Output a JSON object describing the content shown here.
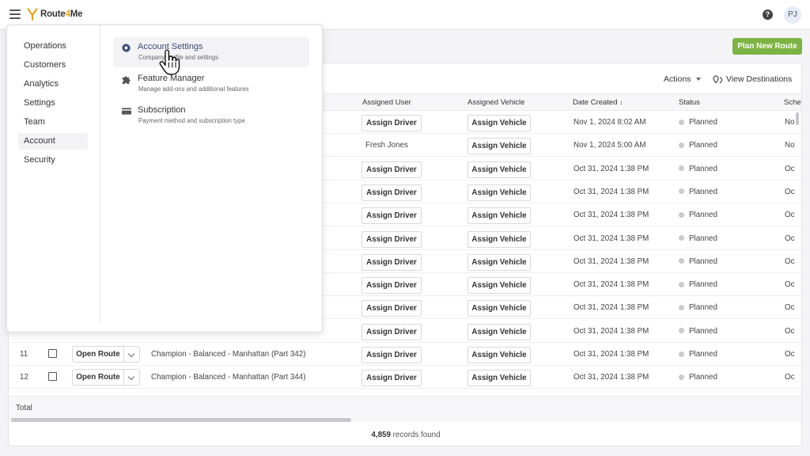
{
  "topbar": {
    "logo": {
      "text_a": "Route",
      "text_b": "4",
      "text_c": "Me"
    },
    "help_glyph": "?",
    "avatar_initials": "PJ"
  },
  "header": {
    "plan_button": "Plan New Route"
  },
  "toolbar": {
    "actions": "Actions",
    "view_destinations": "View Destinations"
  },
  "table": {
    "columns": {
      "assigned_user": "Assigned User",
      "assigned_vehicle": "Assigned Vehicle",
      "date_created": "Date Created",
      "status": "Status",
      "schedule": "Sched"
    },
    "rows": [
      {
        "user": "Assign Driver",
        "user_is_button": true,
        "vehicle": "Assign Vehicle",
        "date": "Nov 1, 2024 8:02 AM",
        "status": "Planned",
        "sched": "No"
      },
      {
        "user": "Fresh Jones",
        "user_is_button": false,
        "vehicle": "Assign Vehicle",
        "date": "Nov 1, 2024 5:00 AM",
        "status": "Planned",
        "sched": "No"
      },
      {
        "user": "Assign Driver",
        "user_is_button": true,
        "vehicle": "Assign Vehicle",
        "date": "Oct 31, 2024 1:38 PM",
        "status": "Planned",
        "sched": "Oc"
      },
      {
        "user": "Assign Driver",
        "user_is_button": true,
        "vehicle": "Assign Vehicle",
        "date": "Oct 31, 2024 1:38 PM",
        "status": "Planned",
        "sched": "Oc"
      },
      {
        "user": "Assign Driver",
        "user_is_button": true,
        "vehicle": "Assign Vehicle",
        "date": "Oct 31, 2024 1:38 PM",
        "status": "Planned",
        "sched": "Oc"
      },
      {
        "user": "Assign Driver",
        "user_is_button": true,
        "vehicle": "Assign Vehicle",
        "date": "Oct 31, 2024 1:38 PM",
        "status": "Planned",
        "sched": "Oc"
      },
      {
        "user": "Assign Driver",
        "user_is_button": true,
        "vehicle": "Assign Vehicle",
        "date": "Oct 31, 2024 1:38 PM",
        "status": "Planned",
        "sched": "Oc"
      },
      {
        "user": "Assign Driver",
        "user_is_button": true,
        "vehicle": "Assign Vehicle",
        "date": "Oct 31, 2024 1:38 PM",
        "status": "Planned",
        "sched": "Oc"
      },
      {
        "user": "Assign Driver",
        "user_is_button": true,
        "vehicle": "Assign Vehicle",
        "date": "Oct 31, 2024 1:38 PM",
        "status": "Planned",
        "sched": "Oc"
      },
      {
        "user": "Assign Driver",
        "user_is_button": true,
        "vehicle": "Assign Vehicle",
        "date": "Oct 31, 2024 1:38 PM",
        "status": "Planned",
        "sched": "Oc"
      },
      {
        "num": "11",
        "open": "Open Route",
        "name": "Champion - Balanced - Manhattan (Part 342)",
        "user": "Assign Driver",
        "user_is_button": true,
        "vehicle": "Assign Vehicle",
        "date": "Oct 31, 2024 1:38 PM",
        "status": "Planned",
        "sched": "Oc"
      },
      {
        "num": "12",
        "open": "Open Route",
        "name": "Champion - Balanced - Manhattan (Part 344)",
        "user": "Assign Driver",
        "user_is_button": true,
        "vehicle": "Assign Vehicle",
        "date": "Oct 31, 2024 1:38 PM",
        "status": "Planned",
        "sched": "Oc"
      }
    ],
    "total_label": "Total",
    "records_count": "4,859",
    "records_suffix": " records found"
  },
  "menu": {
    "left_items": [
      "Operations",
      "Customers",
      "Analytics",
      "Settings",
      "Team",
      "Account",
      "Security"
    ],
    "active_left": "Account",
    "sub_items": [
      {
        "title": "Account Settings",
        "desc": "Company profile and settings",
        "icon": "gear-icon"
      },
      {
        "title": "Feature Manager",
        "desc": "Manage add-ons and additional features",
        "icon": "puzzle-icon"
      },
      {
        "title": "Subscription",
        "desc": "Payment method and subscription type",
        "icon": "credit-card-icon"
      }
    ]
  },
  "colors": {
    "accent_green": "#7cb342",
    "logo_orange": "#e8a41c",
    "menu_active_text": "#3a4a7a"
  }
}
